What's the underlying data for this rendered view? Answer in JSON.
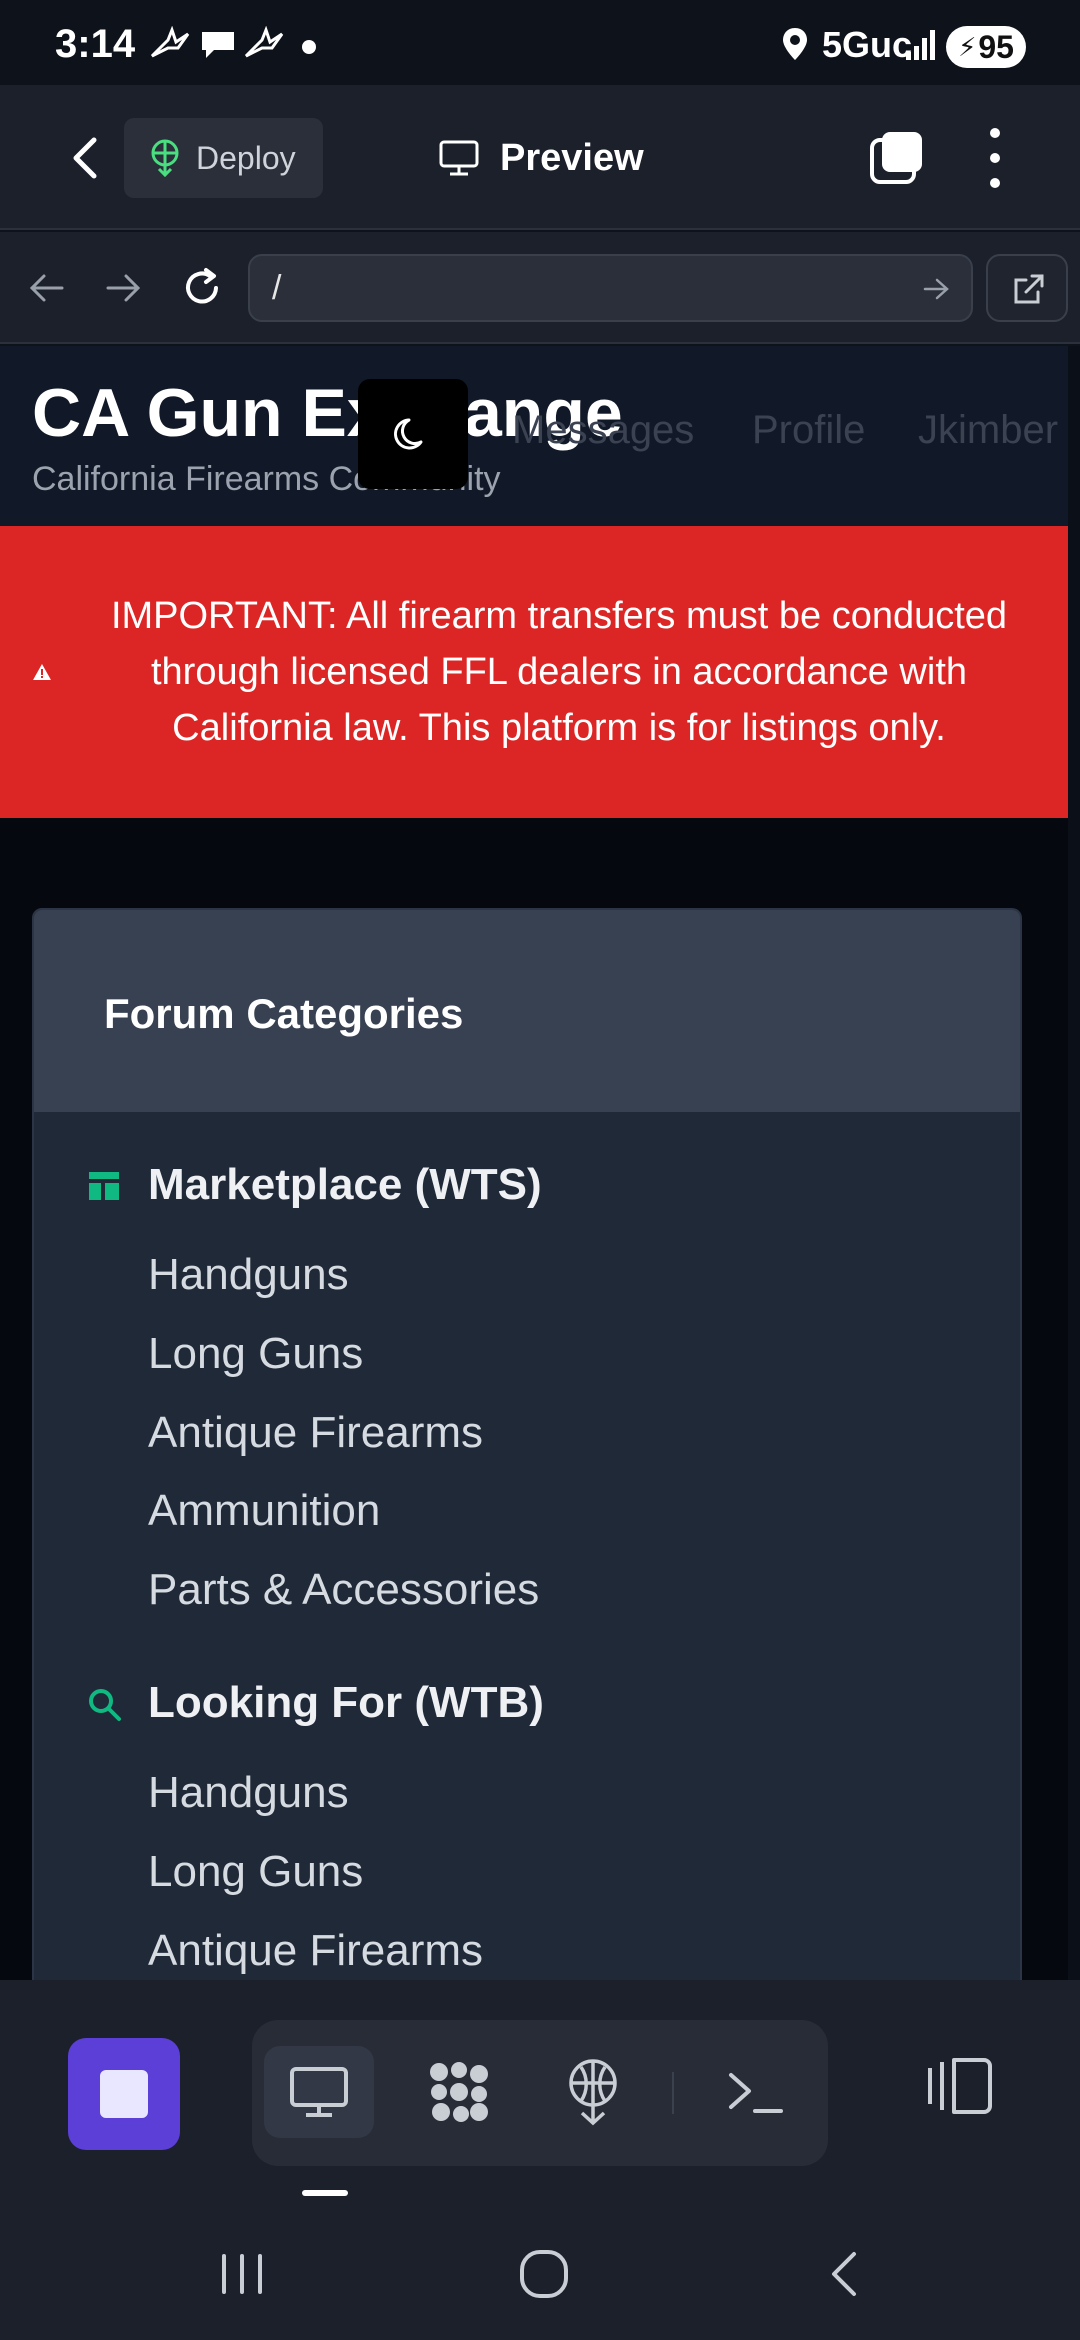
{
  "status_bar": {
    "time": "3:14",
    "network": "5Guc",
    "battery": "95",
    "icons": [
      "bird-icon",
      "chat-bubble-icon",
      "bird-icon",
      "dot-icon",
      "location-icon",
      "signal-icon",
      "battery-charging-icon"
    ]
  },
  "toolbar": {
    "deploy_label": "Deploy",
    "preview_label": "Preview",
    "icons": [
      "back-icon",
      "deploy-icon",
      "monitor-icon",
      "window-icon",
      "more-vertical-icon"
    ]
  },
  "browser": {
    "url": "/",
    "icons": [
      "arrow-left-icon",
      "arrow-right-icon",
      "reload-icon",
      "go-arrow-icon",
      "external-link-icon"
    ]
  },
  "site": {
    "title": "CA Gun Exchange",
    "subtitle": "California Firearms Community",
    "nav": [
      "Messages",
      "Profile",
      "Jkimber"
    ],
    "theme_icon": "moon-icon",
    "accent_color": "#10b981",
    "alert": {
      "text": "IMPORTANT: All firearm transfers must be conducted through licensed FFL dealers in accordance with California law. This platform is for listings only.",
      "color": "#dc2626",
      "icon": "warning-icon"
    }
  },
  "forum": {
    "title": "Forum Categories",
    "sections": [
      {
        "icon": "layout-icon",
        "label": "Marketplace (WTS)",
        "items": [
          "Handguns",
          "Long Guns",
          "Antique Firearms",
          "Ammunition",
          "Parts & Accessories"
        ]
      },
      {
        "icon": "search-icon",
        "label": "Looking For (WTB)",
        "items": [
          "Handguns",
          "Long Guns",
          "Antique Firearms"
        ]
      }
    ]
  },
  "dock": {
    "stop_color": "#5b3fd6",
    "tools": [
      "monitor-icon",
      "apps-icon",
      "deploy-icon",
      "terminal-icon"
    ],
    "side_panel_icon": "side-panel-icon"
  },
  "system_nav": [
    "recents-icon",
    "home-icon",
    "back-icon"
  ]
}
